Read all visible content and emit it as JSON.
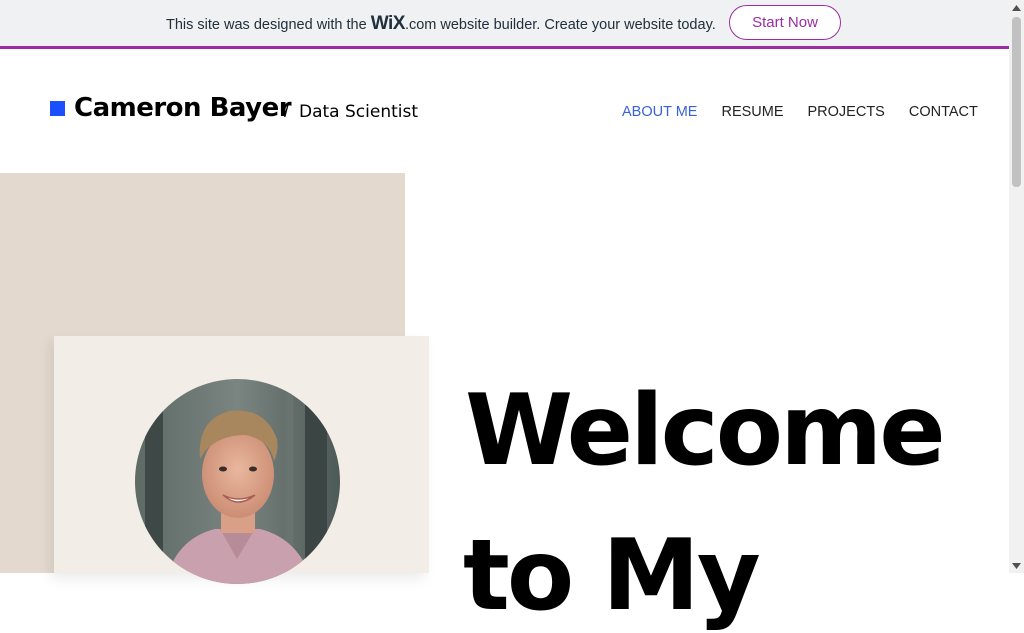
{
  "banner": {
    "text_before": "This site was designed with the ",
    "logo": "WiX",
    "logo_suffix": ".com",
    "text_after": " website builder. Create your website today.",
    "cta_label": "Start Now",
    "accent_color": "#9c2ca3"
  },
  "header": {
    "brand_name": "Cameron Bayer",
    "separator": "/",
    "role": "Data Scientist",
    "brand_color": "#1a4fff"
  },
  "nav": {
    "items": [
      {
        "label": "ABOUT ME",
        "active": true
      },
      {
        "label": "RESUME",
        "active": false
      },
      {
        "label": "PROJECTS",
        "active": false
      },
      {
        "label": "CONTACT",
        "active": false
      }
    ],
    "active_color": "#3a62d8"
  },
  "hero": {
    "heading_line1": "Welcome",
    "heading_line2": "to My",
    "photo_icon": "profile-photo"
  }
}
